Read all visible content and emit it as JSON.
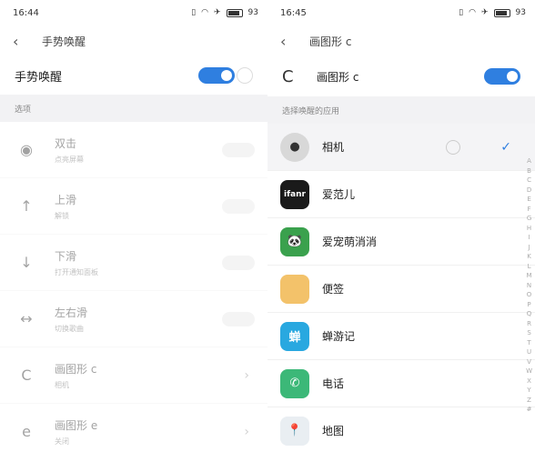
{
  "left": {
    "status": {
      "time": "16:44",
      "battery": "93"
    },
    "header": {
      "title": "手势唤醒"
    },
    "master": {
      "label": "手势唤醒"
    },
    "section_label": "选项",
    "options": [
      {
        "name": "双击",
        "desc": "点亮屏幕",
        "icon": "double-tap-icon",
        "glyph": "◉",
        "control": "toggle"
      },
      {
        "name": "上滑",
        "desc": "解锁",
        "icon": "swipe-up-icon",
        "glyph": "↑",
        "control": "toggle"
      },
      {
        "name": "下滑",
        "desc": "打开通知面板",
        "icon": "swipe-down-icon",
        "glyph": "↓",
        "control": "toggle"
      },
      {
        "name": "左右滑",
        "desc": "切换歌曲",
        "icon": "swipe-left-right-icon",
        "glyph": "↔",
        "control": "toggle"
      },
      {
        "name": "画图形 c",
        "desc": "相机",
        "icon": "draw-c-icon",
        "glyph": "C",
        "control": "chevron"
      },
      {
        "name": "画图形 e",
        "desc": "关闭",
        "icon": "draw-e-icon",
        "glyph": "e",
        "control": "chevron"
      }
    ]
  },
  "right": {
    "status": {
      "time": "16:45",
      "battery": "93"
    },
    "header": {
      "title": "画图形 c"
    },
    "gesture": {
      "label": "画图形 c"
    },
    "section_label": "选择唤醒的应用",
    "apps": [
      {
        "name": "相机",
        "icon": "camera-app-icon",
        "glyph": "●",
        "bg": "#d8d8d8",
        "fg": "#333333",
        "selected": true
      },
      {
        "name": "爱范儿",
        "icon": "ifanr-app-icon",
        "glyph": "ifanr",
        "bg": "#1a1a1a",
        "fg": "#ffffff",
        "selected": false
      },
      {
        "name": "爱宠萌消消",
        "icon": "pet-game-app-icon",
        "glyph": "🐼",
        "bg": "#3aa14d",
        "fg": "#ffffff",
        "selected": false
      },
      {
        "name": "便签",
        "icon": "notes-app-icon",
        "glyph": "",
        "bg": "#f3c26a",
        "fg": "#ffffff",
        "selected": false
      },
      {
        "name": "蝉游记",
        "icon": "chanyouji-app-icon",
        "glyph": "蝉",
        "bg": "#29a8e0",
        "fg": "#ffffff",
        "selected": false
      },
      {
        "name": "电话",
        "icon": "phone-app-icon",
        "glyph": "✆",
        "bg": "#3cb878",
        "fg": "#ffffff",
        "selected": false
      },
      {
        "name": "地图",
        "icon": "map-app-icon",
        "glyph": "📍",
        "bg": "#e9eef2",
        "fg": "#d33",
        "selected": false
      }
    ],
    "alphabet": [
      "A",
      "B",
      "C",
      "D",
      "E",
      "F",
      "G",
      "H",
      "I",
      "J",
      "K",
      "L",
      "M",
      "N",
      "O",
      "P",
      "Q",
      "R",
      "S",
      "T",
      "U",
      "V",
      "W",
      "X",
      "Y",
      "Z",
      "#"
    ]
  },
  "colors": {
    "accent": "#2f7fe0",
    "section_bg": "#f2f2f4"
  }
}
